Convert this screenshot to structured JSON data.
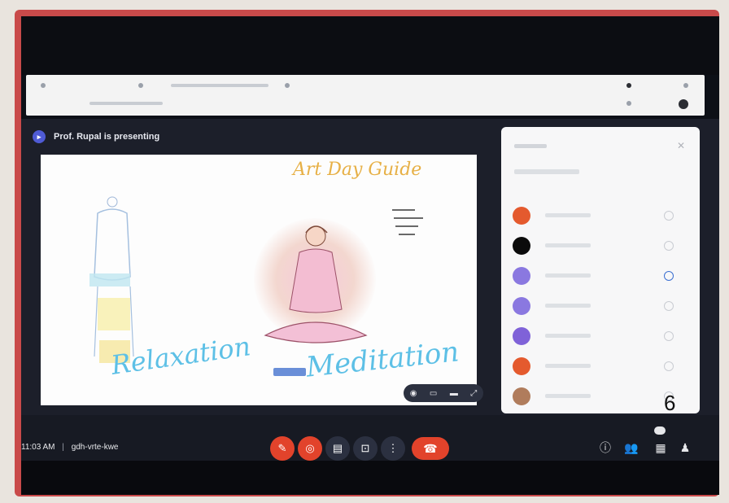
{
  "meeting": {
    "presenter_text": "Prof. Rupal is presenting",
    "time": "11:03 AM",
    "separator": "|",
    "meeting_code": "gdh-vrte-kwe",
    "participant_count": "6"
  },
  "slide": {
    "texts": {
      "top_script": "Art Day Guide",
      "relaxation": "Relaxation",
      "meditation": "Meditation",
      "note": "…"
    }
  },
  "participants": {
    "avatars": [
      {
        "color": "#e45a2e"
      },
      {
        "color": "#0b0b0b"
      },
      {
        "color": "#8a78e0"
      },
      {
        "color": "#8a78e0"
      },
      {
        "color": "#7f62d8"
      },
      {
        "color": "#e45a2e"
      },
      {
        "color": "#b07c5c"
      }
    ]
  },
  "controls": {
    "mic_icon": "mic-off-icon",
    "cam_icon": "camera-off-icon",
    "cc_icon": "captions-icon",
    "present_icon": "present-icon",
    "more_icon": "more-icon",
    "end_icon": "end-call-icon"
  },
  "colors": {
    "accent_red": "#e2432b",
    "accent_blue": "#4f5bd5",
    "frame_red": "#c94a4a"
  }
}
